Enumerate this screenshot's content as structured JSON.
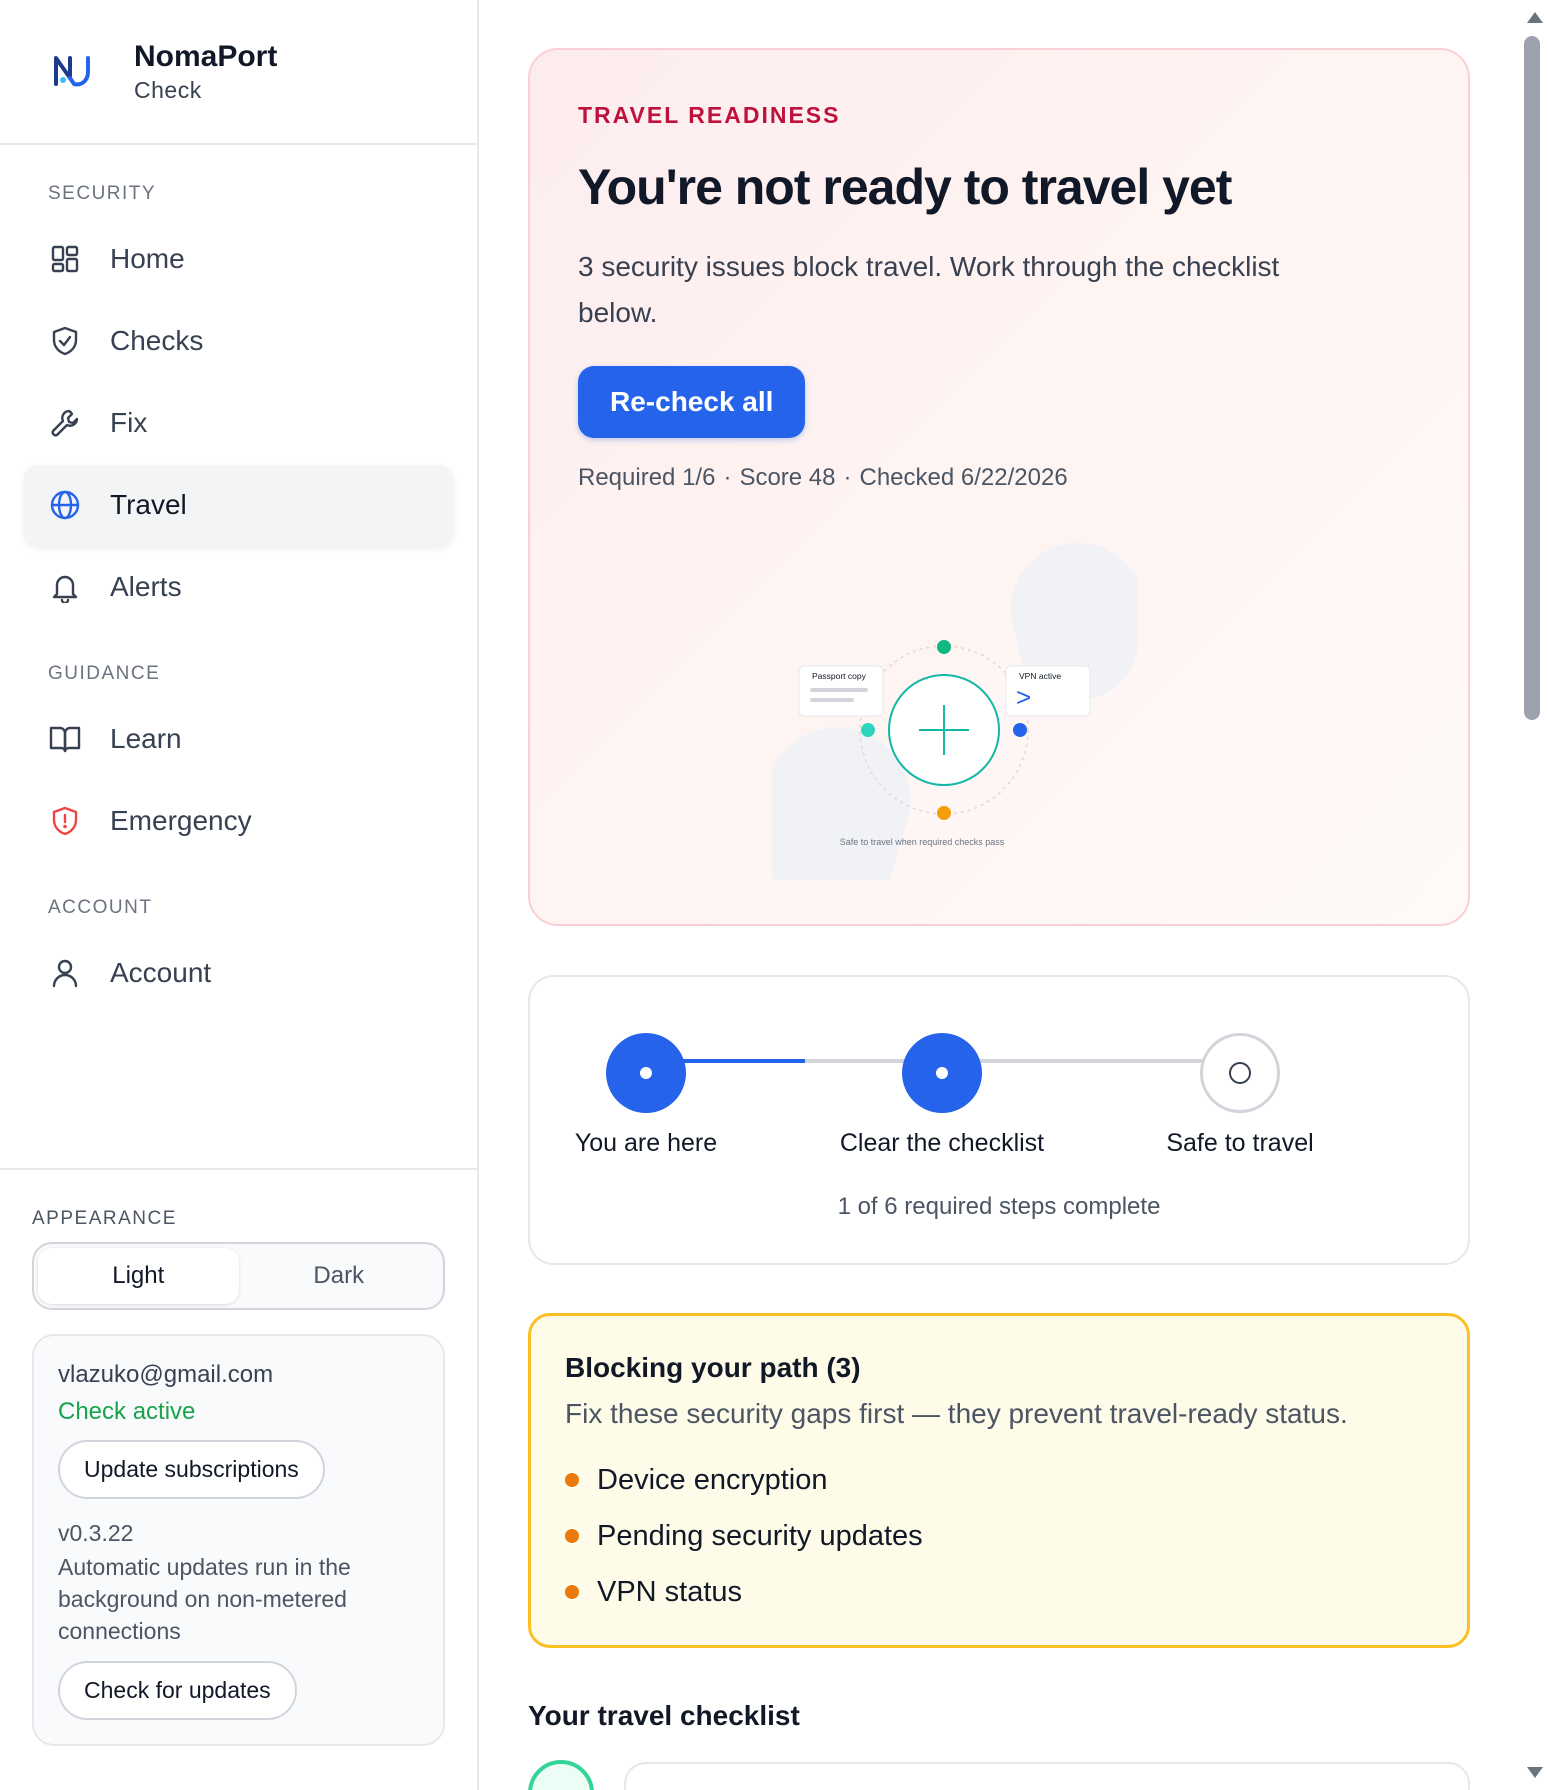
{
  "brand": {
    "name": "NomaPort",
    "subtitle": "Check"
  },
  "nav": {
    "security_heading": "SECURITY",
    "guidance_heading": "GUIDANCE",
    "account_heading": "ACCOUNT",
    "items": {
      "home": "Home",
      "checks": "Checks",
      "fix": "Fix",
      "travel": "Travel",
      "alerts": "Alerts",
      "learn": "Learn",
      "emergency": "Emergency",
      "account": "Account"
    },
    "active": "travel"
  },
  "appearance": {
    "heading": "APPEARANCE",
    "light": "Light",
    "dark": "Dark",
    "selected": "light"
  },
  "account_card": {
    "email": "vlazuko@gmail.com",
    "status": "Check active",
    "update_subscriptions": "Update subscriptions",
    "version": "v0.3.22",
    "note": "Automatic updates run in the background on non-metered connections",
    "check_updates": "Check for updates"
  },
  "hero": {
    "kicker": "TRAVEL READINESS",
    "title": "You're not ready to travel yet",
    "description": "3 security issues block travel. Work through the checklist below.",
    "recheck_button": "Re-check all",
    "meta": {
      "required": "Required 1/6",
      "score": "Score 48",
      "checked": "Checked 6/22/2026",
      "separator": "·"
    },
    "illustration": {
      "card_left": "Passport copy",
      "card_right": "VPN active",
      "card_right_glyph": ">",
      "caption": "Safe to travel when required checks pass"
    }
  },
  "progress": {
    "steps": [
      {
        "label": "You are here",
        "state": "done"
      },
      {
        "label": "Clear the checklist",
        "state": "done"
      },
      {
        "label": "Safe to travel",
        "state": "todo"
      }
    ],
    "summary": "1 of 6 required steps complete",
    "fill_fraction": 0.25
  },
  "blocking": {
    "title": "Blocking your path (3)",
    "description": "Fix these security gaps first — they prevent travel-ready status.",
    "items": [
      "Device encryption",
      "Pending security updates",
      "VPN status"
    ]
  },
  "checklist": {
    "title": "Your travel checklist"
  },
  "colors": {
    "accent": "#2563eb",
    "danger_text": "#be123c",
    "success": "#16a34a",
    "warning_border": "#fbbf24",
    "bullet": "#ea7a0c"
  }
}
